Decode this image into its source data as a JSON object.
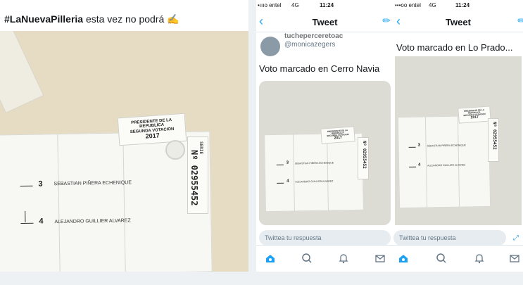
{
  "left_tweet": {
    "hashtag": "#LaNuevaPilleria",
    "text": " esta vez no podrá ✍️",
    "photo": {
      "tab_line1": "PRESIDENTE DE LA REPUBLICA",
      "tab_line2": "SEGUNDA VOTACION",
      "tab_line3": "2017",
      "serial": "Nº 02955452",
      "serie_label": "SERIE",
      "candidate1_num": "3",
      "candidate1_name": "SEBASTIAN PIÑERA ECHENIQUE",
      "candidate2_num": "4",
      "candidate2_name": "ALEJANDRO GUILLIER ALVAREZ"
    }
  },
  "phone1": {
    "status": {
      "carrier": "•ıııo entel",
      "network": "4G",
      "time": "11:24"
    },
    "nav": {
      "back": "‹",
      "title": "Tweet",
      "compose": "✏"
    },
    "handle_cut": "tucheperceretoac",
    "handle": "@monicazegers",
    "text": "Voto marcado en Cerro Navia",
    "reply_placeholder": "Twittea tu respuesta",
    "photo": {
      "tab_line1": "PRESIDENTE DE LA REPUBLICA",
      "tab_line2": "SEGUNDA VOTACION",
      "tab_line3": "2017",
      "serial": "Nº 02955452",
      "candidate1_num": "3",
      "candidate1_name": "SEBASTIAN PIÑERA ECHENIQUE",
      "candidate2_num": "4",
      "candidate2_name": "ALEJANDRO GUILLIER ALVAREZ"
    }
  },
  "phone2": {
    "status": {
      "carrier": "•••oo entel",
      "network": "4G",
      "time": "11:24"
    },
    "nav": {
      "back": "‹",
      "title": "Tweet",
      "compose": "✏"
    },
    "text": "Voto marcado en Lo Prado...",
    "reply_placeholder": "Twittea tu respuesta",
    "photo": {
      "tab_line1": "PRESIDENTE DE LA REPUBLICA",
      "tab_line2": "SEGUNDA VOTACION",
      "tab_line3": "2017",
      "serial": "Nº 02955452",
      "candidate1_num": "3",
      "candidate1_name": "SEBASTIAN PIÑERA ECHENIQUE",
      "candidate2_num": "4",
      "candidate2_name": "ALEJANDRO GUILLIER ALVAREZ"
    }
  },
  "icons": {
    "home": "home-icon",
    "search": "search-icon",
    "notifications": "bell-icon",
    "messages": "mail-icon",
    "expand": "expand-icon"
  },
  "colors": {
    "twitter_blue": "#1da1f2",
    "paper": "#f7f7f4",
    "table": "#e6dcc4"
  }
}
